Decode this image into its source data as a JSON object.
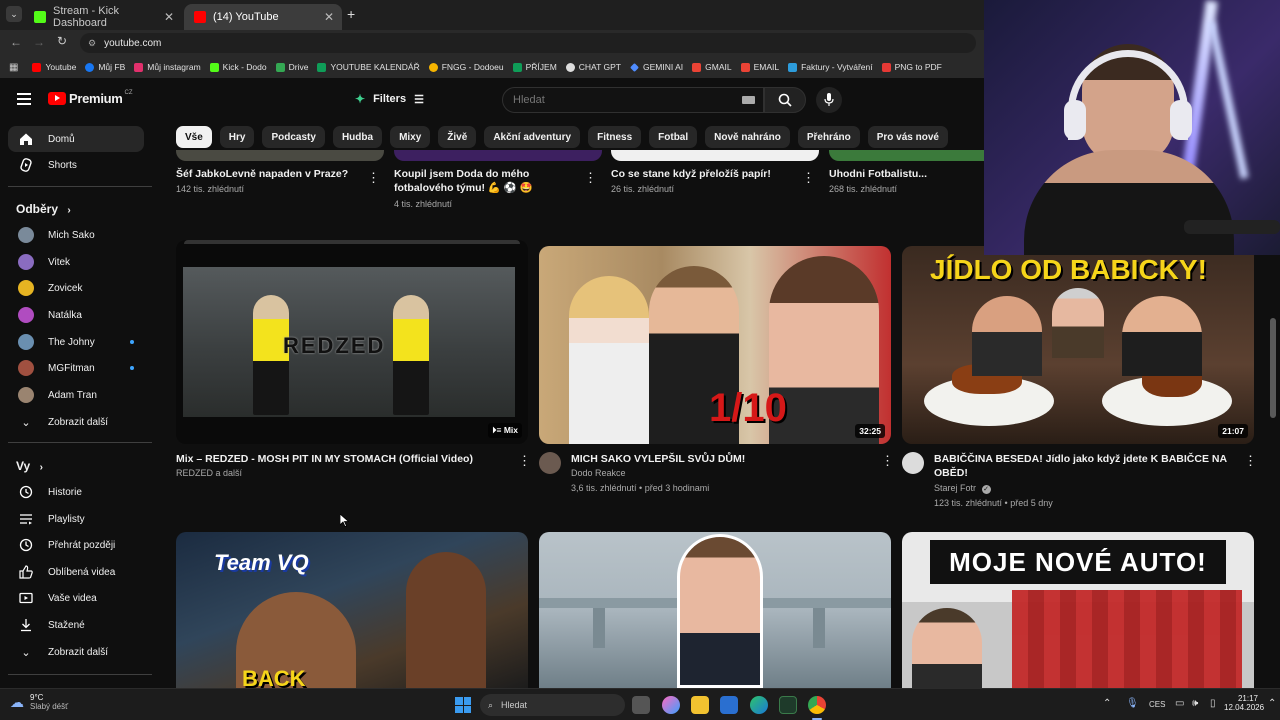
{
  "browser": {
    "tabs": [
      {
        "title": "Stream - Kick Dashboard",
        "favicon_color": "#53fc18"
      },
      {
        "title": "(14) YouTube",
        "favicon_color": "#ff0000"
      }
    ],
    "url": "youtube.com",
    "bookmarks": [
      {
        "label": "Youtube",
        "color": "#ff0000"
      },
      {
        "label": "Můj FB",
        "color": "#1877f2"
      },
      {
        "label": "Můj instagram",
        "color": "#e1306c"
      },
      {
        "label": "Kick - Dodo",
        "color": "#53fc18"
      },
      {
        "label": "Drive",
        "color": "#34a853"
      },
      {
        "label": "YOUTUBE KALENDÁŘ",
        "color": "#0f9d58"
      },
      {
        "label": "FNGG - Dodoeu",
        "color": "#f5b400"
      },
      {
        "label": "PŘÍJEM",
        "color": "#0f9d58"
      },
      {
        "label": "CHAT GPT",
        "color": "#dddddd"
      },
      {
        "label": "GEMINI AI",
        "color": "#4f8cff"
      },
      {
        "label": "GMAIL",
        "color": "#ea4335"
      },
      {
        "label": "EMAIL",
        "color": "#ea4335"
      },
      {
        "label": "Faktury - Vytváření",
        "color": "#2d9cdb"
      },
      {
        "label": "PNG to PDF",
        "color": "#e53935"
      }
    ]
  },
  "youtube": {
    "logo_text": "Premium",
    "region": "CZ",
    "filters_label": "Filters",
    "search_placeholder": "Hledat",
    "chips": [
      "Vše",
      "Hry",
      "Podcasty",
      "Hudba",
      "Mixy",
      "Živě",
      "Akční adventury",
      "Fitness",
      "Fotbal",
      "Nově nahráno",
      "Přehráno",
      "Pro vás nové"
    ]
  },
  "sidebar": {
    "main": [
      {
        "label": "Domů",
        "icon": "home-icon"
      },
      {
        "label": "Shorts",
        "icon": "shorts-icon"
      }
    ],
    "subscriptions_title": "Odběry",
    "subscriptions": [
      {
        "label": "Mich Sako",
        "color": "#7a8a9a"
      },
      {
        "label": "Vitek",
        "color": "#8a6cc0"
      },
      {
        "label": "Zovicek",
        "color": "#e6b422"
      },
      {
        "label": "Natálka",
        "color": "#b04cc0"
      },
      {
        "label": "The Johny",
        "color": "#6a8fb0"
      },
      {
        "label": "MGFitman",
        "color": "#a05040"
      },
      {
        "label": "Adam Tran",
        "color": "#9a8470"
      }
    ],
    "show_more": "Zobrazit další",
    "you_title": "Vy",
    "you_items": [
      {
        "label": "Historie",
        "icon": "history-icon"
      },
      {
        "label": "Playlisty",
        "icon": "playlist-icon"
      },
      {
        "label": "Přehrát později",
        "icon": "clock-icon"
      },
      {
        "label": "Oblíbená videa",
        "icon": "thumbs-up-icon"
      },
      {
        "label": "Vaše videa",
        "icon": "video-icon"
      },
      {
        "label": "Stažené",
        "icon": "download-icon"
      }
    ],
    "show_more_2": "Zobrazit další"
  },
  "shorts_row": [
    {
      "title": "Šéf JabkoLevně napaden v Praze?",
      "meta": "142 tis. zhlédnutí"
    },
    {
      "title": "Koupil jsem Doda do mého fotbalového týmu! 💪 ⚽ 🤩",
      "meta": "4 tis. zhlédnutí"
    },
    {
      "title": "Co se stane když přeložíš papír!",
      "meta": "26 tis. zhlédnutí"
    },
    {
      "title": "Uhodni Fotbalistu...",
      "meta": "268 tis. zhlédnutí"
    }
  ],
  "videos_row": [
    {
      "title": "Mix – REDZED - MOSH PIT IN MY STOMACH (Official Video)",
      "channel": "REDZED a další",
      "stats": "",
      "badge": "Mix",
      "thumb_text": "REDZED"
    },
    {
      "title": "MICH SAKO VYLEPŠIL SVŮJ DŮM!",
      "channel": "Dodo Reakce",
      "stats": "3,6 tis. zhlédnutí • před 3 hodinami",
      "duration": "32:25",
      "thumb_text": "1/10"
    },
    {
      "title": "BABIČČINA BESEDA! Jídlo jako když jdete K BABIČCE NA OBĚD!",
      "channel": "Starej Fotr",
      "stats": "123 tis. zhlédnutí • před 5 dny",
      "duration": "21:07",
      "thumb_text": "JÍDLO OD BABICKY!"
    }
  ],
  "bottom_row": [
    {
      "thumb_text": "Team VQ",
      "thumb_text_2": "BACK"
    },
    {
      "thumb_text": ""
    },
    {
      "thumb_text": "MOJE NOVÉ AUTO!"
    }
  ],
  "taskbar": {
    "weather_temp": "9°C",
    "weather_desc": "Slabý déšť",
    "search_placeholder": "Hledat",
    "lang": "CES",
    "time": "21:17",
    "date": "12.04.2026"
  }
}
